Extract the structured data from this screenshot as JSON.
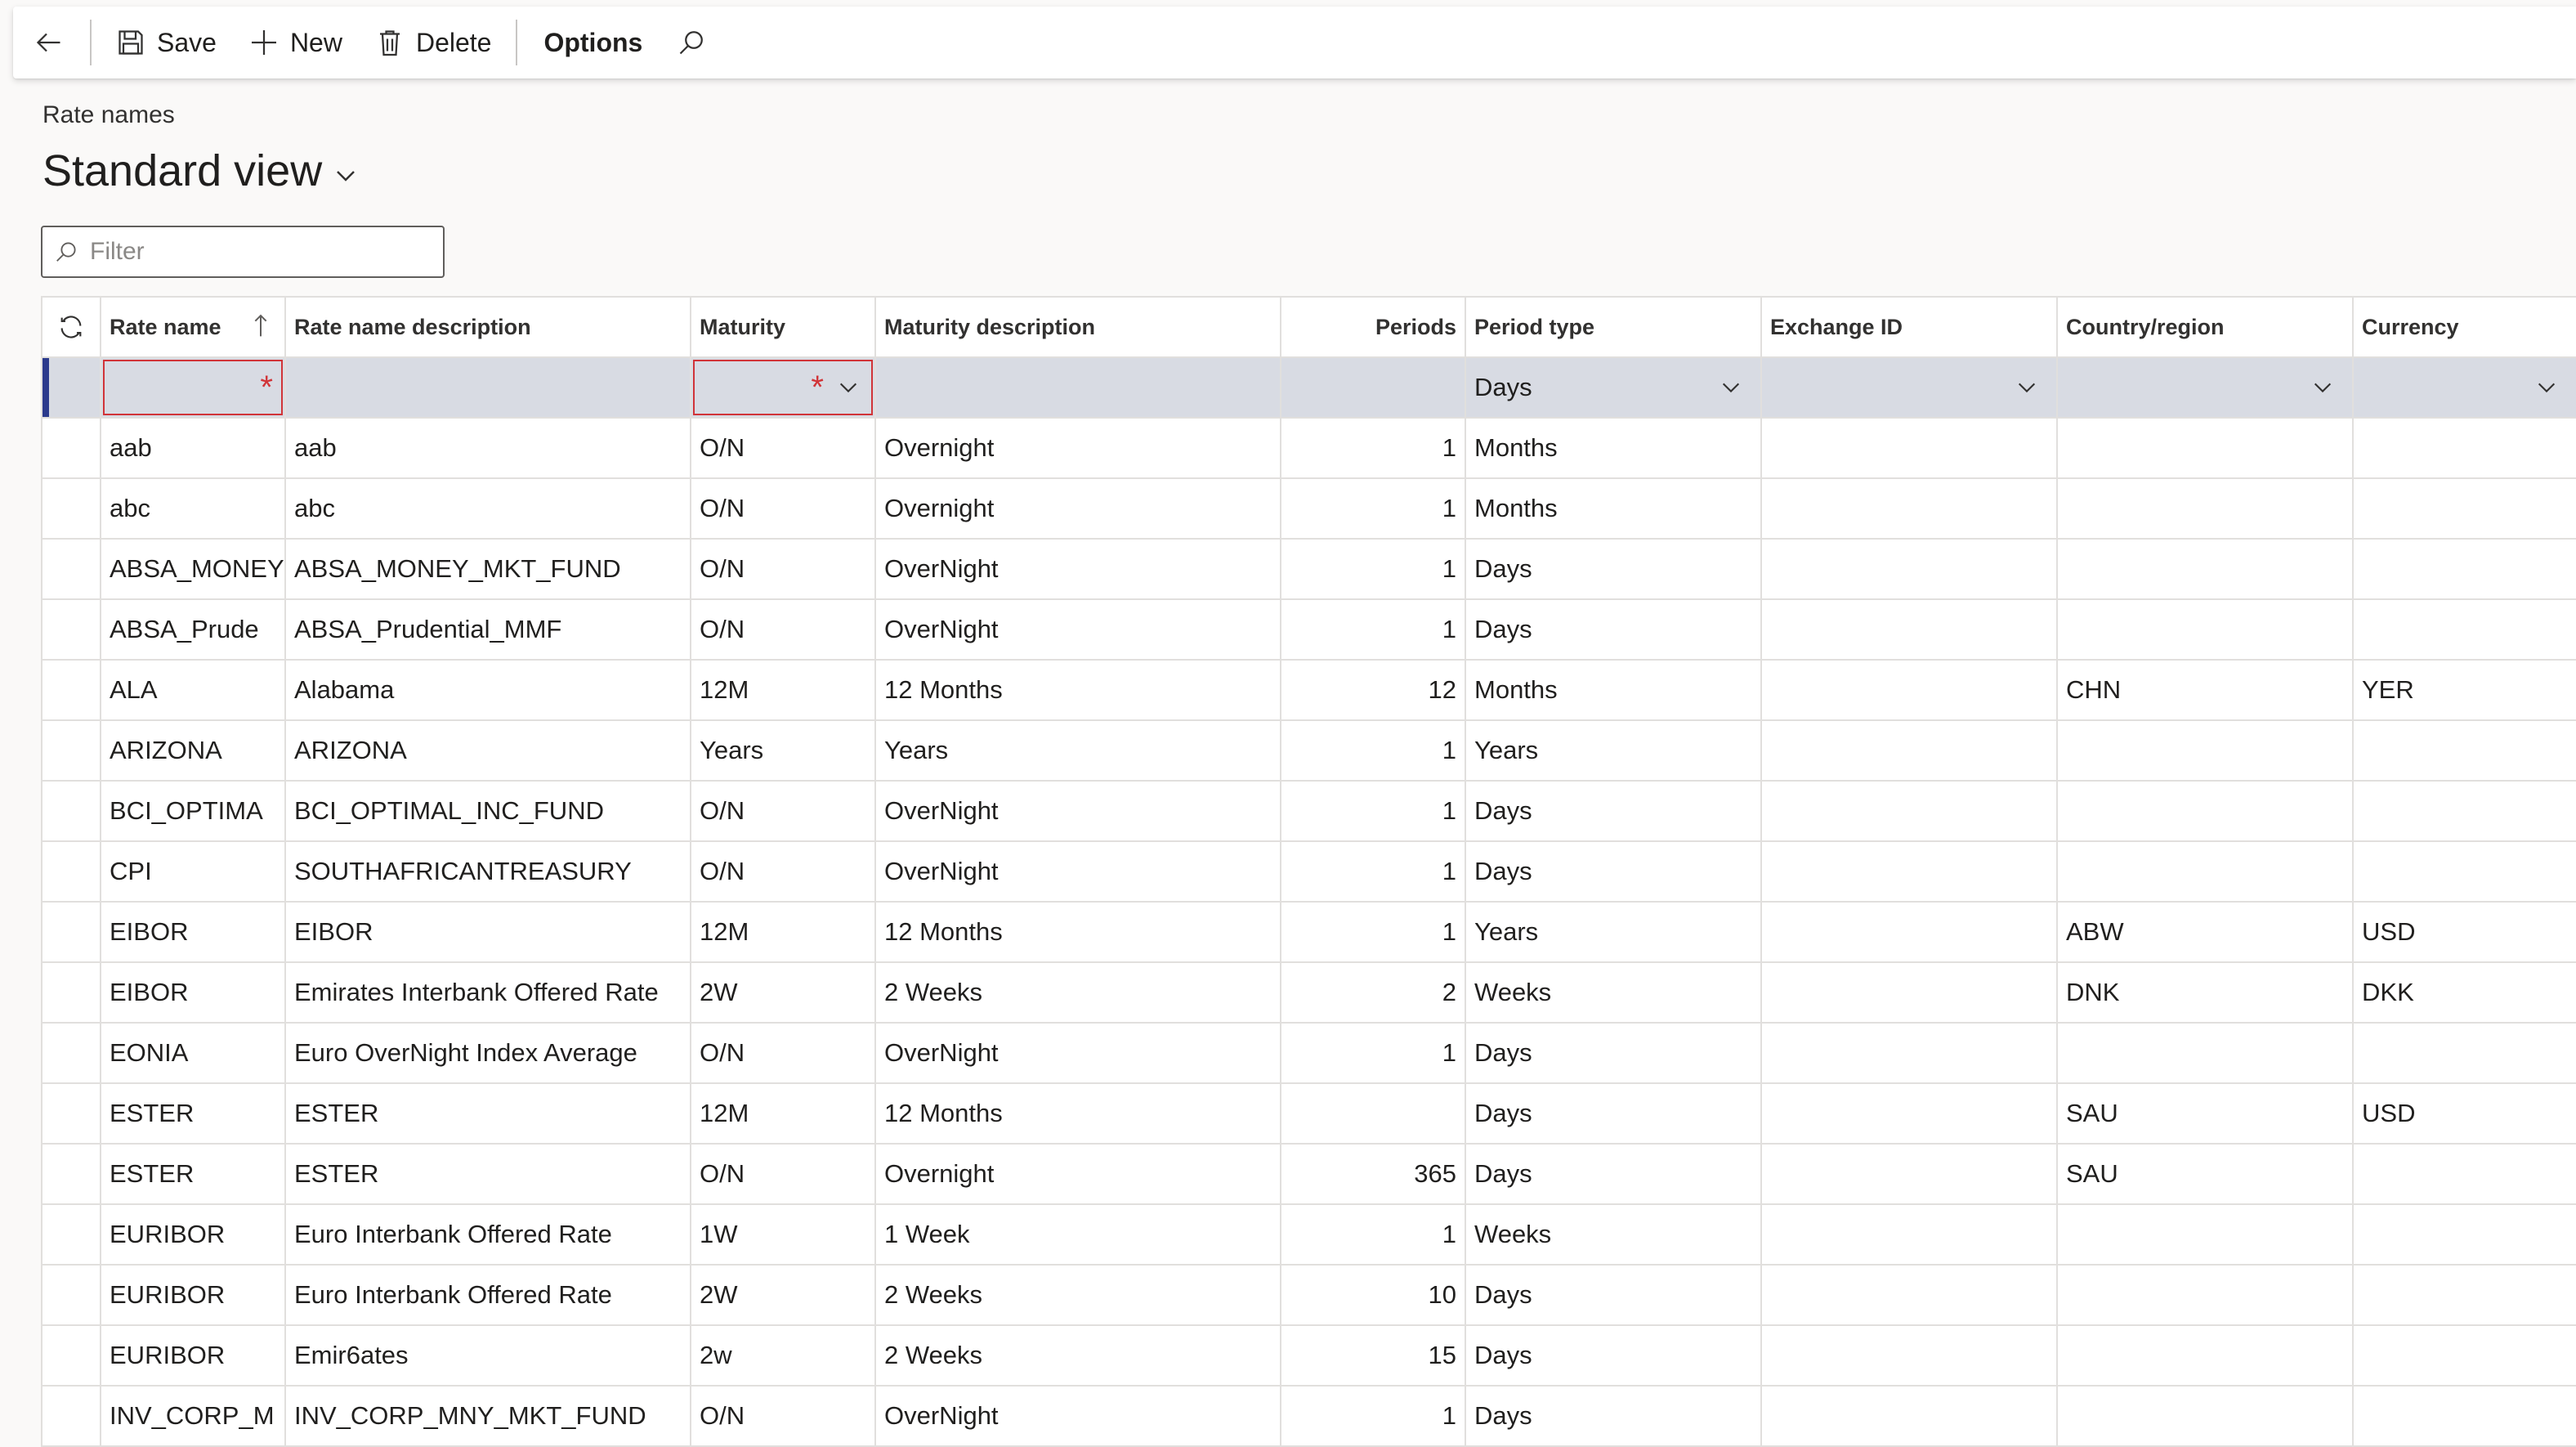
{
  "toolbar": {
    "save_label": "Save",
    "new_label": "New",
    "delete_label": "Delete",
    "options_label": "Options"
  },
  "page": {
    "caption": "Rate names",
    "view_title": "Standard view"
  },
  "filter": {
    "placeholder": "Filter"
  },
  "grid": {
    "headers": {
      "rate_name": "Rate name",
      "rate_name_description": "Rate name description",
      "maturity": "Maturity",
      "maturity_description": "Maturity description",
      "periods": "Periods",
      "period_type": "Period type",
      "exchange_id": "Exchange ID",
      "country_region": "Country/region",
      "currency": "Currency"
    },
    "new_row": {
      "period_type": "Days",
      "required_marker": "*"
    },
    "rows": [
      {
        "rate_name": "aab",
        "description": "aab",
        "maturity": "O/N",
        "maturity_description": "Overnight",
        "periods": "1",
        "period_type": "Months",
        "exchange_id": "",
        "country_region": "",
        "currency": ""
      },
      {
        "rate_name": "abc",
        "description": "abc",
        "maturity": "O/N",
        "maturity_description": "Overnight",
        "periods": "1",
        "period_type": "Months",
        "exchange_id": "",
        "country_region": "",
        "currency": ""
      },
      {
        "rate_name": "ABSA_MONEY",
        "description": "ABSA_MONEY_MKT_FUND",
        "maturity": "O/N",
        "maturity_description": "OverNight",
        "periods": "1",
        "period_type": "Days",
        "exchange_id": "",
        "country_region": "",
        "currency": ""
      },
      {
        "rate_name": "ABSA_Prude",
        "description": "ABSA_Prudential_MMF",
        "maturity": "O/N",
        "maturity_description": "OverNight",
        "periods": "1",
        "period_type": "Days",
        "exchange_id": "",
        "country_region": "",
        "currency": ""
      },
      {
        "rate_name": "ALA",
        "description": "Alabama",
        "maturity": "12M",
        "maturity_description": "12 Months",
        "periods": "12",
        "period_type": "Months",
        "exchange_id": "",
        "country_region": "CHN",
        "currency": "YER"
      },
      {
        "rate_name": "ARIZONA",
        "description": "ARIZONA",
        "maturity": "Years",
        "maturity_description": "Years",
        "periods": "1",
        "period_type": "Years",
        "exchange_id": "",
        "country_region": "",
        "currency": ""
      },
      {
        "rate_name": "BCI_OPTIMA",
        "description": "BCI_OPTIMAL_INC_FUND",
        "maturity": "O/N",
        "maturity_description": "OverNight",
        "periods": "1",
        "period_type": "Days",
        "exchange_id": "",
        "country_region": "",
        "currency": ""
      },
      {
        "rate_name": "CPI",
        "description": "SOUTHAFRICANTREASURY",
        "maturity": "O/N",
        "maturity_description": "OverNight",
        "periods": "1",
        "period_type": "Days",
        "exchange_id": "",
        "country_region": "",
        "currency": ""
      },
      {
        "rate_name": "EIBOR",
        "description": "EIBOR",
        "maturity": "12M",
        "maturity_description": "12 Months",
        "periods": "1",
        "period_type": "Years",
        "exchange_id": "",
        "country_region": "ABW",
        "currency": "USD"
      },
      {
        "rate_name": "EIBOR",
        "description": "Emirates Interbank Offered Rate",
        "maturity": "2W",
        "maturity_description": "2 Weeks",
        "periods": "2",
        "period_type": "Weeks",
        "exchange_id": "",
        "country_region": "DNK",
        "currency": "DKK"
      },
      {
        "rate_name": "EONIA",
        "description": "Euro OverNight Index Average",
        "maturity": "O/N",
        "maturity_description": "OverNight",
        "periods": "1",
        "period_type": "Days",
        "exchange_id": "",
        "country_region": "",
        "currency": ""
      },
      {
        "rate_name": "ESTER",
        "description": "ESTER",
        "maturity": "12M",
        "maturity_description": "12 Months",
        "periods": "",
        "period_type": "Days",
        "exchange_id": "",
        "country_region": "SAU",
        "currency": "USD"
      },
      {
        "rate_name": "ESTER",
        "description": "ESTER",
        "maturity": "O/N",
        "maturity_description": "Overnight",
        "periods": "365",
        "period_type": "Days",
        "exchange_id": "",
        "country_region": "SAU",
        "currency": ""
      },
      {
        "rate_name": "EURIBOR",
        "description": "Euro Interbank Offered Rate",
        "maturity": "1W",
        "maturity_description": "1 Week",
        "periods": "1",
        "period_type": "Weeks",
        "exchange_id": "",
        "country_region": "",
        "currency": ""
      },
      {
        "rate_name": "EURIBOR",
        "description": "Euro Interbank Offered Rate",
        "maturity": "2W",
        "maturity_description": "2 Weeks",
        "periods": "10",
        "period_type": "Days",
        "exchange_id": "",
        "country_region": "",
        "currency": ""
      },
      {
        "rate_name": "EURIBOR",
        "description": "Emir6ates",
        "maturity": "2w",
        "maturity_description": "2 Weeks",
        "periods": "15",
        "period_type": "Days",
        "exchange_id": "",
        "country_region": "",
        "currency": ""
      },
      {
        "rate_name": "INV_CORP_M",
        "description": "INV_CORP_MNY_MKT_FUND",
        "maturity": "O/N",
        "maturity_description": "OverNight",
        "periods": "1",
        "period_type": "Days",
        "exchange_id": "",
        "country_region": "",
        "currency": ""
      }
    ]
  }
}
